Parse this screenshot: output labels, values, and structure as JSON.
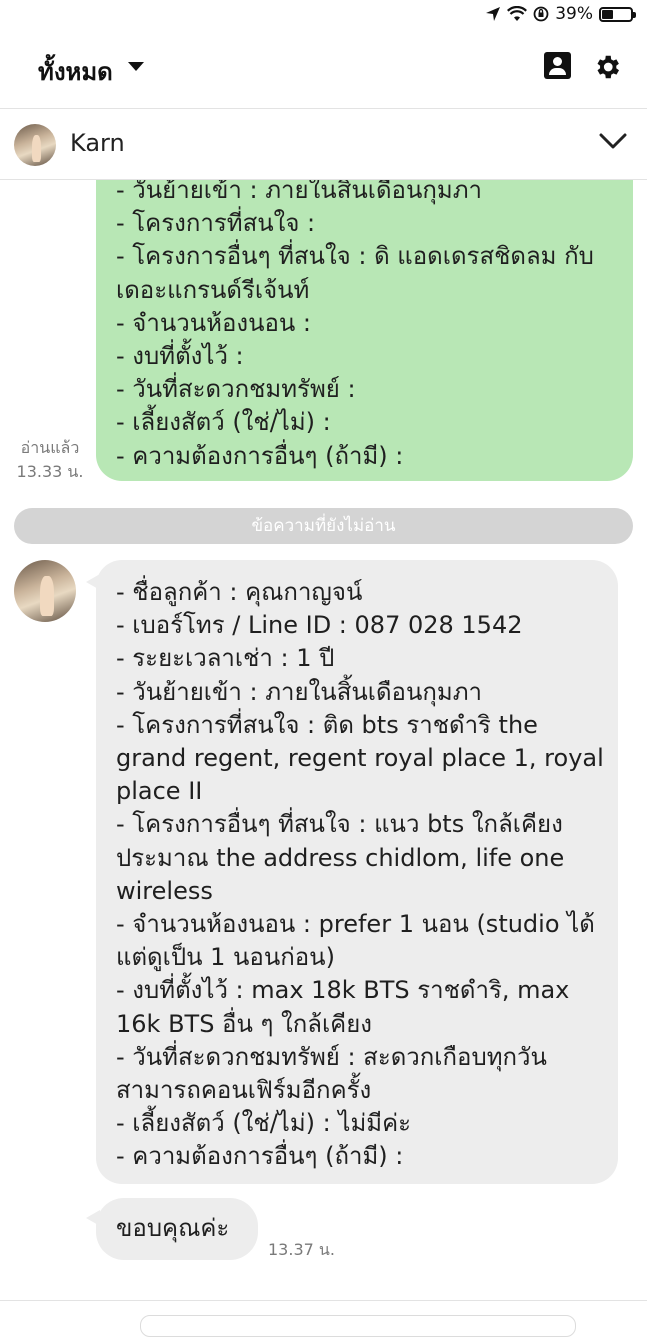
{
  "status_bar": {
    "battery_percent": "39%",
    "battery_level": 0.39
  },
  "header": {
    "title": "ทั้งหมด"
  },
  "chat": {
    "contact_name": "Karn"
  },
  "messages": {
    "outgoing_text": "- วันย้ายเข้า : ภายในสิ้นเดือนกุมภา\n- โครงการที่สนใจ :\n- โครงการอื่นๆ ที่สนใจ : ดิ แอดเดรสชิดลม กับ เดอะแกรนด์รีเจ้นท์\n- จำนวนห้องนอน :\n- งบที่ตั้งไว้ :\n- วันที่สะดวกชมทรัพย์ :\n- เลี้ยงสัตว์ (ใช่/ไม่) :\n- ความต้องการอื่นๆ (ถ้ามี) :",
    "read_label": "อ่านแล้ว",
    "read_time": "13.33 น.",
    "unread_divider": "ข้อความที่ยังไม่อ่าน",
    "incoming_text": "- ชื่อลูกค้า : คุณกาญจน์\n- เบอร์โทร / Line ID : 087 028 1542\n- ระยะเวลาเช่า : 1 ปี\n- วันย้ายเข้า : ภายในสิ้นเดือนกุมภา\n- โครงการที่สนใจ : ติด bts ราชดำริ the grand regent, regent royal place 1, royal place II\n- โครงการอื่นๆ ที่สนใจ : แนว bts ใกล้เคียง ประมาณ the address chidlom, life one wireless\n- จำนวนห้องนอน : prefer 1 นอน (studio ได้แต่ดูเป็น 1 นอนก่อน)\n- งบที่ตั้งไว้ : max 18k BTS ราชดำริ, max 16k BTS อื่น ๆ ใกล้เคียง\n- วันที่สะดวกชมทรัพย์ : สะดวกเกือบทุกวัน สามารถคอนเฟิร์มอีกครั้ง\n- เลี้ยงสัตว์ (ใช่/ไม่) : ไม่มีค่ะ\n- ความต้องการอื่นๆ (ถ้ามี) :",
    "thanks_text": "ขอบคุณค่ะ",
    "thanks_time": "13.37 น."
  },
  "icons": {
    "location": "location-arrow-icon",
    "wifi": "wifi-icon",
    "lock_rotation": "orientation-lock-icon",
    "battery": "battery-icon",
    "dropdown": "caret-down-icon",
    "contacts": "contact-book-icon",
    "settings": "gear-icon",
    "collapse": "chevron-down-icon"
  },
  "colors": {
    "outgoing_bubble": "#b8e7b5",
    "incoming_bubble": "#ededed",
    "divider": "#d4d4d4"
  }
}
